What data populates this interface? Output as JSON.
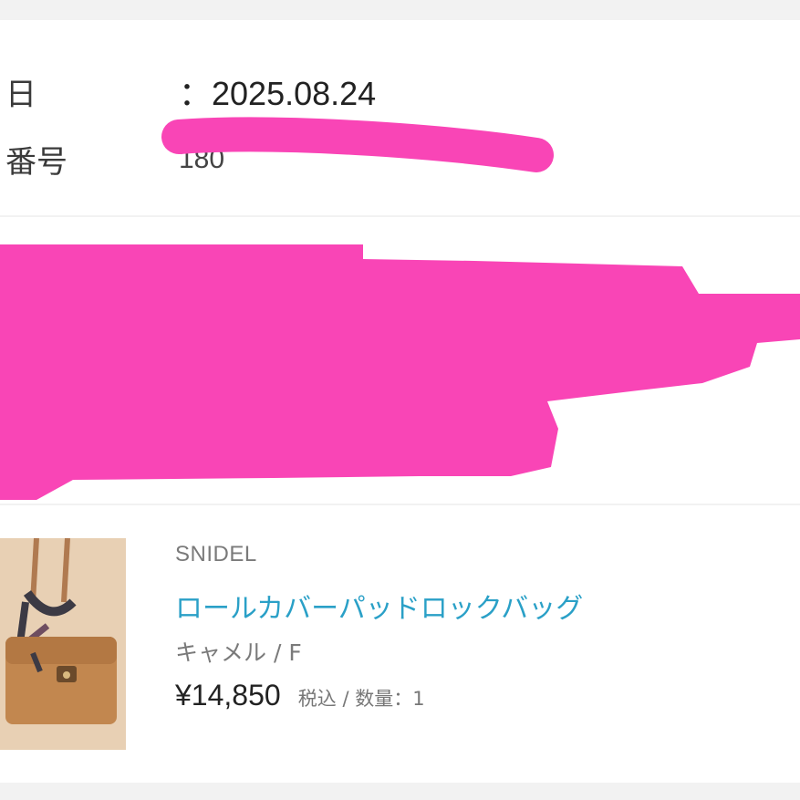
{
  "order": {
    "date_label": "日",
    "date_value": "：2025.08.24",
    "number_label": "番号",
    "number_value": "180"
  },
  "product": {
    "brand": "SNIDEL",
    "name": "ロールカバーパッドロックバッグ",
    "variant": "キャメル / F",
    "price": "¥14,850",
    "tax_label": "税込",
    "separator": " / ",
    "quantity_label": "数量：1"
  },
  "colors": {
    "redaction": "#f945b6",
    "link": "#2aa0c7",
    "background": "#f2f2f2"
  }
}
